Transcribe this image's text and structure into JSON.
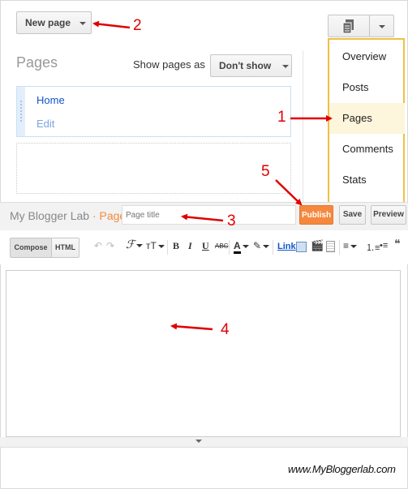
{
  "top": {
    "new_page_button": "New page"
  },
  "pages_panel": {
    "title": "Pages",
    "show_pages_label": "Show pages as",
    "show_pages_value": "Don't show",
    "pages": [
      {
        "name": "Home",
        "action": "Edit"
      }
    ]
  },
  "menu": {
    "items": [
      "Overview",
      "Posts",
      "Pages",
      "Comments",
      "Stats"
    ],
    "active": "Pages"
  },
  "editor": {
    "brand": "My Blogger Lab",
    "separator": "·",
    "section": "Page",
    "title_placeholder": "Page title",
    "publish_label": "Publish",
    "save_label": "Save",
    "preview_label": "Preview",
    "compose_tab": "Compose",
    "html_tab": "HTML",
    "toolbar": {
      "bold": "B",
      "italic": "I",
      "underline": "U",
      "strike": "ABC",
      "font": "ℱ",
      "size": "тT",
      "text_color": "A",
      "link": "Link",
      "quote": "❝"
    }
  },
  "annotations": {
    "n1": "1",
    "n2": "2",
    "n3": "3",
    "n4": "4",
    "n5": "5"
  },
  "watermark": "www.MyBloggerlab.com",
  "colors": {
    "publish": "#f6883e",
    "highlight": "#fdf5dc",
    "menu_border": "#f0c040",
    "link": "#1155cc",
    "annotation": "#e00000"
  }
}
